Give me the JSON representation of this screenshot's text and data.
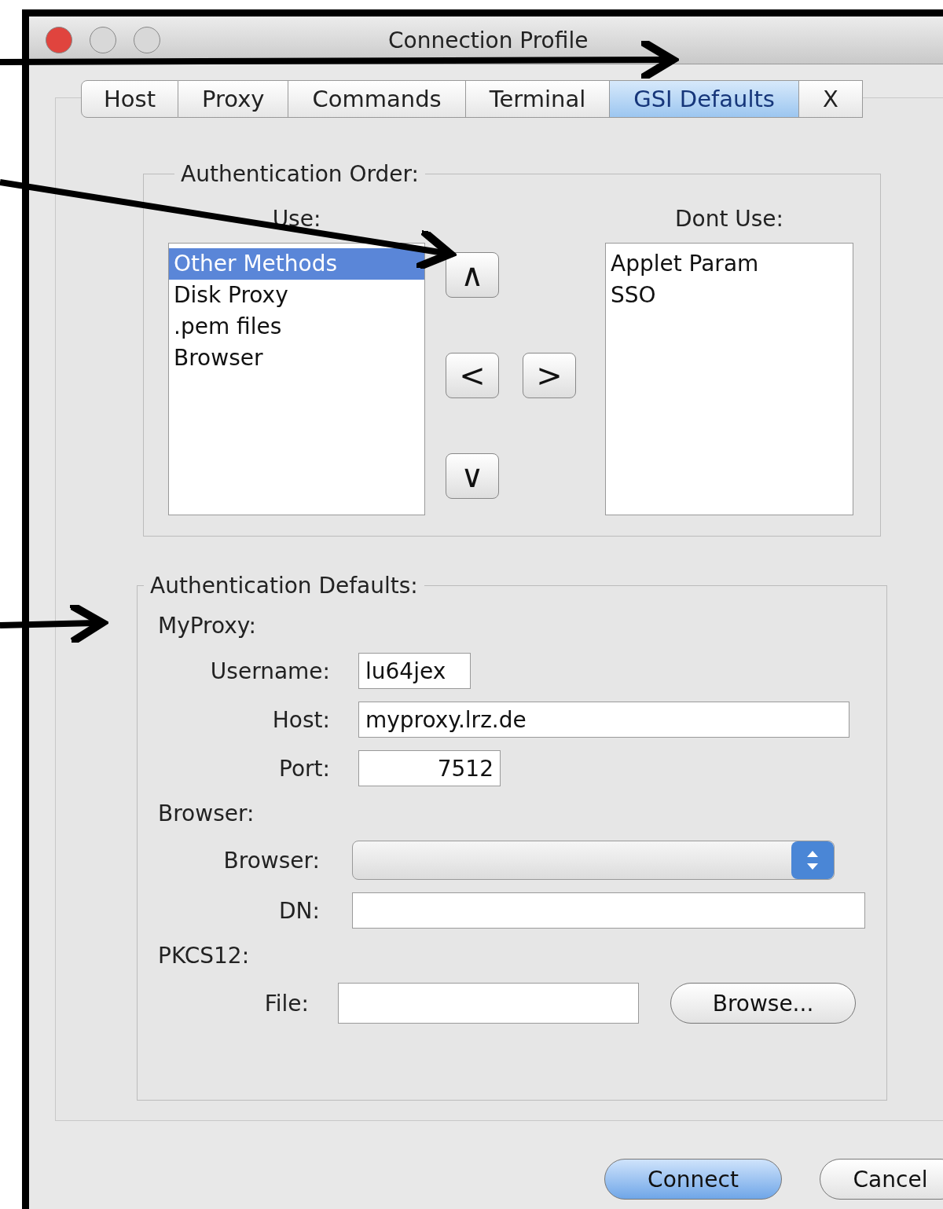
{
  "window": {
    "title": "Connection Profile"
  },
  "tabs": [
    {
      "label": "Host",
      "selected": false
    },
    {
      "label": "Proxy",
      "selected": false
    },
    {
      "label": "Commands",
      "selected": false
    },
    {
      "label": "Terminal",
      "selected": false
    },
    {
      "label": "GSI Defaults",
      "selected": true
    },
    {
      "label": "X",
      "selected": false
    }
  ],
  "authentication_order": {
    "title": "Authentication Order:",
    "use_label": "Use:",
    "dont_use_label": "Dont Use:",
    "use_items": [
      {
        "label": "Other Methods",
        "selected": true
      },
      {
        "label": "Disk Proxy",
        "selected": false
      },
      {
        "label": ".pem files",
        "selected": false
      },
      {
        "label": "Browser",
        "selected": false
      }
    ],
    "dont_use_items": [
      {
        "label": "Applet Param",
        "selected": false
      },
      {
        "label": "SSO",
        "selected": false
      }
    ],
    "move_buttons": [
      {
        "kind": "up",
        "label": "∧"
      },
      {
        "kind": "left",
        "label": "<"
      },
      {
        "kind": "right",
        "label": ">"
      },
      {
        "kind": "down",
        "label": "∨"
      }
    ]
  },
  "authentication_defaults": {
    "title": "Authentication Defaults:",
    "sections": [
      {
        "title": "MyProxy:",
        "rows": [
          {
            "kind": "field",
            "label": "Username:",
            "value": "lu64jex"
          },
          {
            "kind": "field",
            "label": "Host:",
            "value": "myproxy.lrz.de"
          },
          {
            "kind": "field",
            "label": "Port:",
            "value": "7512"
          }
        ]
      },
      {
        "title": "Browser:",
        "rows": [
          {
            "kind": "select",
            "label": "Browser:"
          },
          {
            "kind": "field",
            "label": "DN:"
          }
        ]
      },
      {
        "title": "PKCS12:",
        "rows": [
          {
            "kind": "file",
            "label": "File:",
            "button": "Browse..."
          }
        ]
      }
    ]
  },
  "buttons": [
    {
      "label": "Connect",
      "default": true
    },
    {
      "label": "Cancel",
      "default": false
    }
  ]
}
